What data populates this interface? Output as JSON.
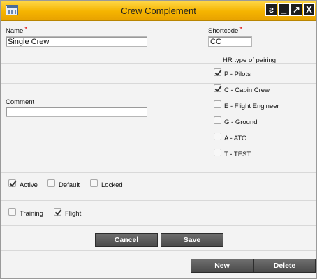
{
  "window": {
    "title": "Crew Complement"
  },
  "titlebar_buttons": {
    "restore": "ƨ",
    "minimize": "_",
    "maximize": "↗",
    "close": "X"
  },
  "form": {
    "name_label": "Name",
    "name_value": "Single Crew",
    "shortcode_label": "Shortcode",
    "shortcode_value": "CC",
    "comment_label": "Comment",
    "comment_value": "",
    "required_mark": "*"
  },
  "hr_pairing": {
    "title": "HR type of pairing",
    "items": [
      {
        "label": "P - Pilots",
        "checked": true
      },
      {
        "label": "C - Cabin Crew",
        "checked": true
      },
      {
        "label": "E - Flight Engineer",
        "checked": false
      },
      {
        "label": "G - Ground",
        "checked": false
      },
      {
        "label": "A - ATO",
        "checked": false
      },
      {
        "label": "T - TEST",
        "checked": false
      }
    ]
  },
  "flags": {
    "active": {
      "label": "Active",
      "checked": true
    },
    "default": {
      "label": "Default",
      "checked": false
    },
    "locked": {
      "label": "Locked",
      "checked": false
    },
    "training": {
      "label": "Training",
      "checked": false
    },
    "flight": {
      "label": "Flight",
      "checked": true
    }
  },
  "buttons": {
    "cancel": "Cancel",
    "save": "Save",
    "new": "New",
    "delete": "Delete"
  }
}
